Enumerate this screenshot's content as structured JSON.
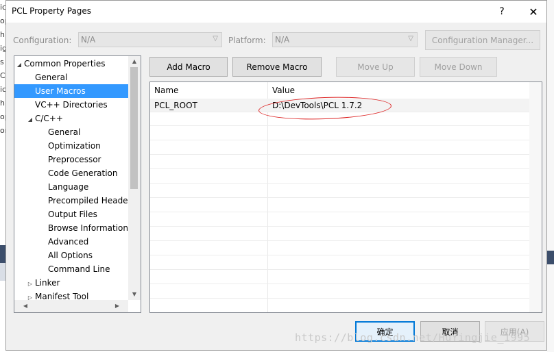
{
  "window": {
    "title": "PCL Property Pages",
    "help_label": "?",
    "close_label": "✕"
  },
  "config": {
    "configuration_label": "Configuration:",
    "configuration_value": "N/A",
    "platform_label": "Platform:",
    "platform_value": "N/A",
    "manager_button": "Configuration Manager..."
  },
  "toolbar": {
    "add_macro": "Add Macro",
    "remove_macro": "Remove Macro",
    "move_up": "Move Up",
    "move_down": "Move Down"
  },
  "tree": {
    "items": [
      {
        "label": "Common Properties",
        "expander": "◢",
        "selected": false
      },
      {
        "label": "General",
        "expander": "",
        "selected": false
      },
      {
        "label": "User Macros",
        "expander": "",
        "selected": true
      },
      {
        "label": "VC++ Directories",
        "expander": "",
        "selected": false
      },
      {
        "label": "C/C++",
        "expander": "◢",
        "selected": false
      },
      {
        "label": "General",
        "expander": "",
        "selected": false
      },
      {
        "label": "Optimization",
        "expander": "",
        "selected": false
      },
      {
        "label": "Preprocessor",
        "expander": "",
        "selected": false
      },
      {
        "label": "Code Generation",
        "expander": "",
        "selected": false
      },
      {
        "label": "Language",
        "expander": "",
        "selected": false
      },
      {
        "label": "Precompiled Headers",
        "expander": "",
        "selected": false
      },
      {
        "label": "Output Files",
        "expander": "",
        "selected": false
      },
      {
        "label": "Browse Information",
        "expander": "",
        "selected": false
      },
      {
        "label": "Advanced",
        "expander": "",
        "selected": false
      },
      {
        "label": "All Options",
        "expander": "",
        "selected": false
      },
      {
        "label": "Command Line",
        "expander": "",
        "selected": false
      },
      {
        "label": "Linker",
        "expander": "▷",
        "selected": false
      },
      {
        "label": "Manifest Tool",
        "expander": "▷",
        "selected": false
      }
    ]
  },
  "grid": {
    "columns": [
      "Name",
      "Value"
    ],
    "rows": [
      {
        "name": "PCL_ROOT",
        "value": "D:\\DevTools\\PCL 1.7.2"
      }
    ]
  },
  "footer": {
    "ok": "确定",
    "cancel": "取消",
    "apply": "应用(A)"
  },
  "watermark": "https://blog.csdn.net/HuYingjie_1995",
  "background": {
    "left_fragments": [
      "ic",
      "op",
      "hi",
      "ig",
      "s",
      "CL",
      "ic",
      "h",
      "op",
      "or"
    ]
  },
  "colors": {
    "selection": "#3399ff",
    "accent": "#0078d7",
    "annotation": "#dd2222"
  }
}
